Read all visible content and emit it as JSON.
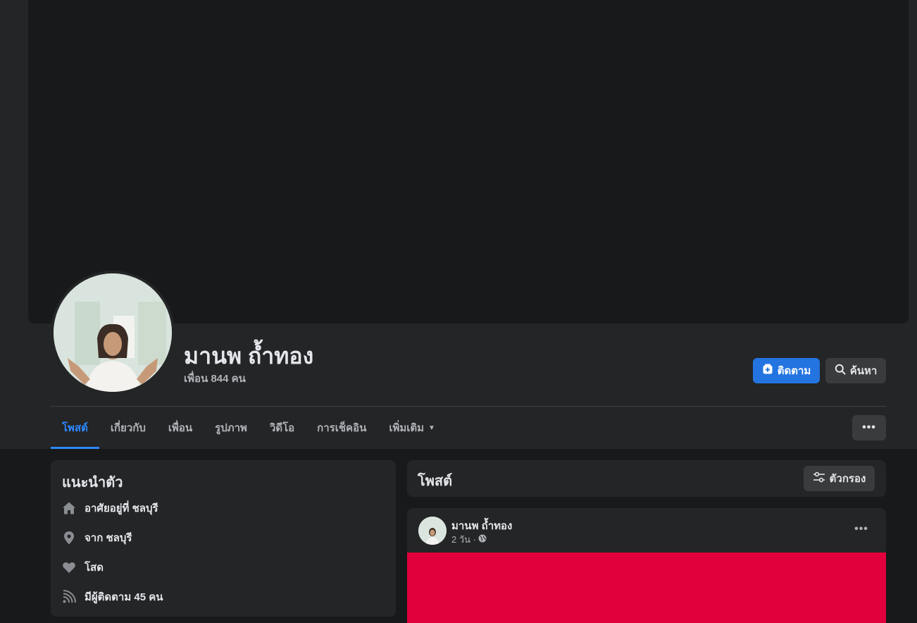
{
  "profile": {
    "name": "มานพ ถ้ำทอง",
    "friends_text": "เพื่อน 844 คน"
  },
  "actions": {
    "follow_label": "ติดตาม",
    "search_label": "ค้นหา",
    "follow_color": "#2374e1"
  },
  "tabs": [
    {
      "label": "โพสต์",
      "active": true
    },
    {
      "label": "เกี่ยวกับ"
    },
    {
      "label": "เพื่อน"
    },
    {
      "label": "รูปภาพ"
    },
    {
      "label": "วิดีโอ"
    },
    {
      "label": "การเช็คอิน"
    },
    {
      "label": "เพิ่มเติม"
    }
  ],
  "more_label": "•••",
  "intro": {
    "title": "แนะนำตัว",
    "items": [
      {
        "icon": "home-icon",
        "text": "อาศัยอยู่ที่ ชลบุรี"
      },
      {
        "icon": "location-pin-icon",
        "text": "จาก ชลบุรี"
      },
      {
        "icon": "heart-icon",
        "text": "โสด"
      },
      {
        "icon": "rss-feed-icon",
        "text": "มีผู้ติดตาม 45 คน"
      }
    ]
  },
  "posts": {
    "title": "โพสต์",
    "filter_label": "ตัวกรอง",
    "items": [
      {
        "author": "มานพ ถ้ำทอง",
        "time": "2 วัน ·",
        "privacy_icon": "globe-icon",
        "media_color": "#e2003c"
      }
    ]
  },
  "colors": {
    "background": "#18191a",
    "surface": "#242526",
    "active_tab": "#2d88ff"
  }
}
